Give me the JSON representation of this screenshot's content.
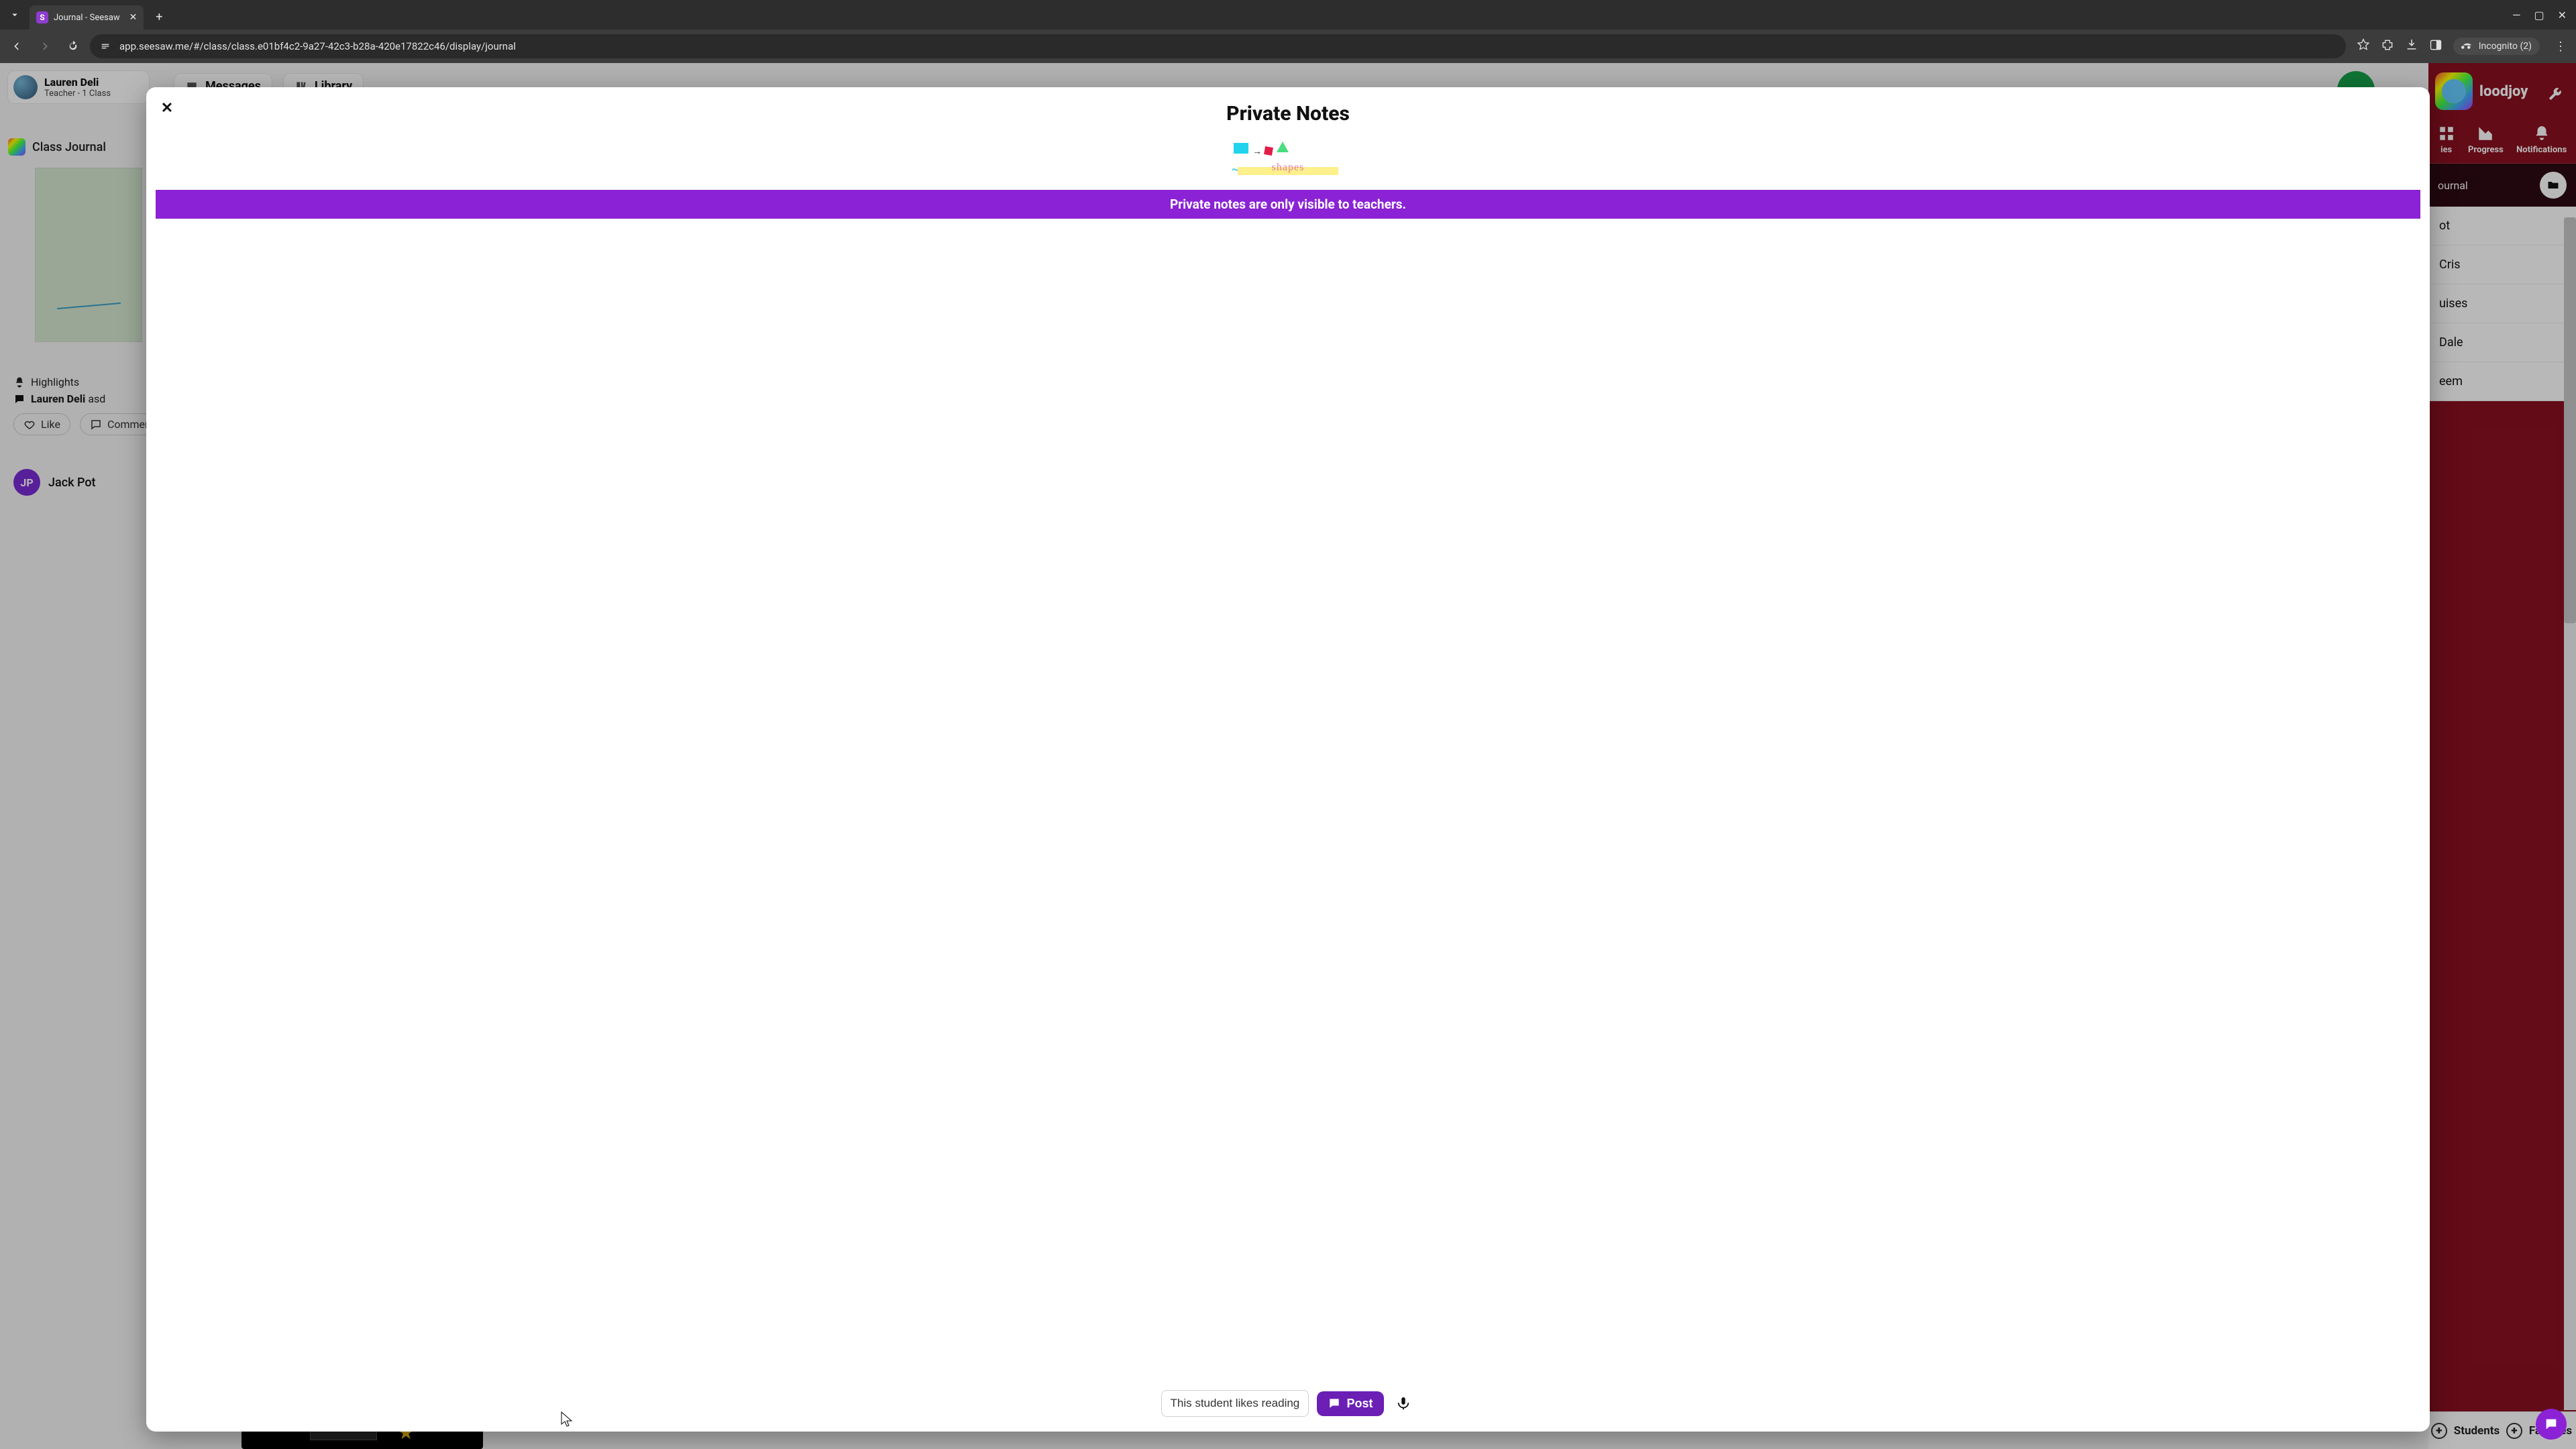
{
  "browser": {
    "tab_title": "Journal - Seesaw",
    "url": "app.seesaw.me/#/class/class.e01bf4c2-9a27-42c3-b28a-420e17822c46/display/journal",
    "incognito_label": "Incognito (2)"
  },
  "header": {
    "user_name": "Lauren Deli",
    "user_role": "Teacher - 1 Class",
    "messages_label": "Messages",
    "library_label": "Library"
  },
  "left": {
    "class_journal_label": "Class Journal",
    "highlights_label": "Highlights",
    "comment_author": "Lauren Deli",
    "comment_text": "asd",
    "like_label": "Like",
    "comment_label": "Commen",
    "next_user_initials": "JP",
    "next_user_name": "Jack Pot"
  },
  "right": {
    "class_name_suffix": "loodjoy",
    "tabs": {
      "activities": "ies",
      "progress": "Progress",
      "notifications": "Notifications"
    },
    "section_label": "ournal",
    "students": [
      "ot",
      "Cris",
      "uises",
      "Dale",
      "eem"
    ],
    "footer": {
      "students": "Students",
      "families": "Families"
    }
  },
  "modal": {
    "title": "Private Notes",
    "banner": "Private notes are only visible to teachers.",
    "input_value": "This student likes reading",
    "post_label": "Post"
  }
}
